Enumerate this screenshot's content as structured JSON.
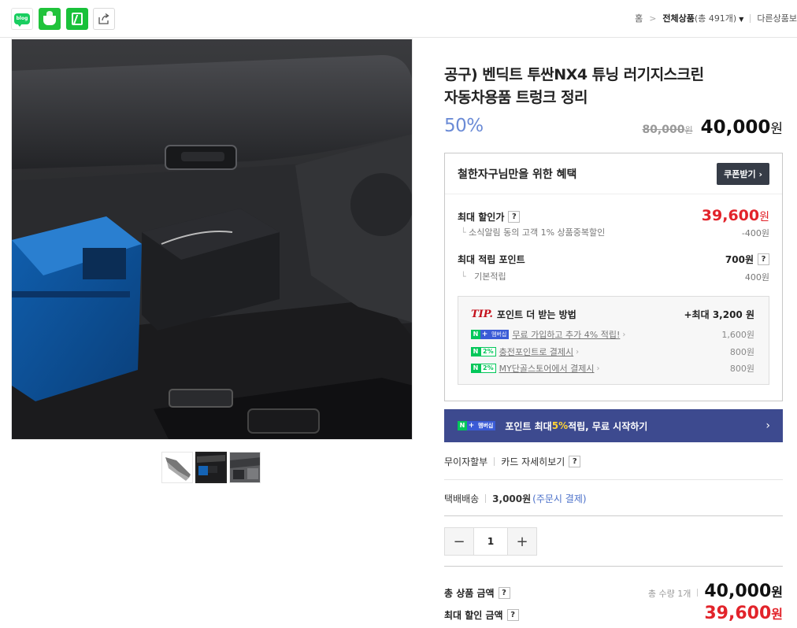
{
  "share": {
    "blog_label": "blog"
  },
  "breadcrumb": {
    "home": "홈",
    "separator": ">",
    "current": "전체상품",
    "count_text": "(총 491개)",
    "other": "다른상품보"
  },
  "product": {
    "title_line1": "공구) 벤딕트 투싼NX4 튜닝 러기지스크린",
    "title_line2": "자동차용품 트렁크 정리",
    "discount_rate": "50%",
    "original_price": "80,000",
    "original_unit": "원",
    "sale_price": "40,000",
    "sale_unit": "원"
  },
  "benefit": {
    "heading": "철한자구님만을 위한 혜택",
    "coupon_button": "쿠폰받기 ›",
    "max_discount_label": "최대 할인가",
    "max_discount_price": "39,600",
    "max_discount_unit": "원",
    "news_alert_text": "소식알림 동의 고객 1% 상품중복할인",
    "news_alert_amount": "-400원",
    "max_point_label": "최대 적립 포인트",
    "max_point_value": "700원",
    "basic_point_label": "기본적립",
    "basic_point_value": "400원",
    "tip": {
      "tip_word": "TIP.",
      "title": "포인트 더 받는 방법",
      "max_label": "+최대 3,200 원",
      "rows": [
        {
          "badge": "membership",
          "text": "무료 가입하고 추가 4% 적립!",
          "amount": "1,600원"
        },
        {
          "badge": "2%",
          "text": "충전포인트로 결제시",
          "amount": "800원"
        },
        {
          "badge": "2%",
          "text": "MY단골스토어에서 결제시",
          "amount": "800원"
        }
      ]
    }
  },
  "npay_badge": {
    "n": "N",
    "plus": "+",
    "membership": "멤버십"
  },
  "member_banner": {
    "text_prefix": "포인트 최대 ",
    "text_highlight": "5%",
    "text_suffix": " 적립, 무료 시작하기",
    "chevron": "›"
  },
  "installment": {
    "label": "무이자할부",
    "card_link": "카드 자세히보기"
  },
  "delivery": {
    "label": "택배배송",
    "fee": "3,000원",
    "note": "(주문시 결제)"
  },
  "quantity": {
    "minus": "−",
    "value": "1",
    "plus": "+"
  },
  "totals": {
    "total_label": "총 상품 금액",
    "total_count": "총 수량 1개",
    "total_price": "40,000",
    "total_unit": "원",
    "max_discount_label": "최대 할인 금액",
    "max_discount_price": "39,600",
    "max_discount_unit": "원"
  },
  "help_mark": "?"
}
